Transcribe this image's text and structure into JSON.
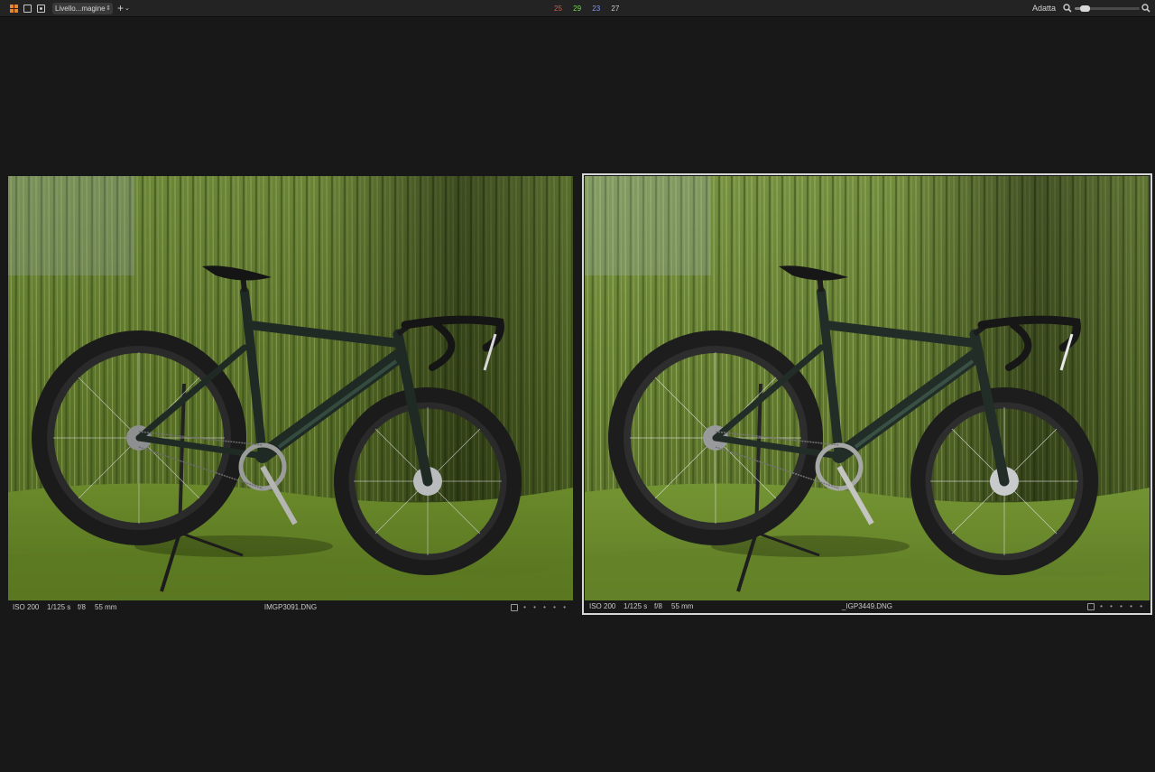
{
  "toolbar": {
    "layer_select": "Livello...magine",
    "add_symbol": "+",
    "add_caret": "⌄",
    "counters": [
      {
        "value": "25",
        "color": "#e2553f"
      },
      {
        "value": "29",
        "color": "#7bd35b"
      },
      {
        "value": "23",
        "color": "#7f96ff"
      },
      {
        "value": "27",
        "color": "#cfcfcf"
      }
    ],
    "fit_label": "Adatta",
    "zoom_level": 0.15,
    "icons": [
      "grid-view-icon",
      "single-view-icon",
      "compare-view-icon",
      "updown-icon",
      "zoom-out-icon",
      "zoom-in-icon"
    ]
  },
  "viewer": {
    "left": {
      "iso": "ISO 200",
      "shutter": "1/125 s",
      "aperture": "f/8",
      "focal": "55 mm",
      "filename": "IMGP3091.DNG",
      "rating_dots": "• • • • •",
      "selected": false
    },
    "right": {
      "iso": "ISO 200",
      "shutter": "1/125 s",
      "aperture": "f/8",
      "focal": "55 mm",
      "filename": "_IGP3449.DNG",
      "rating_dots": "• • • • •",
      "selected": true
    }
  },
  "colors": {
    "background": "#181818",
    "toolbar": "#232323",
    "selection_border": "#d6d6d6",
    "accent": "#e8832e"
  }
}
